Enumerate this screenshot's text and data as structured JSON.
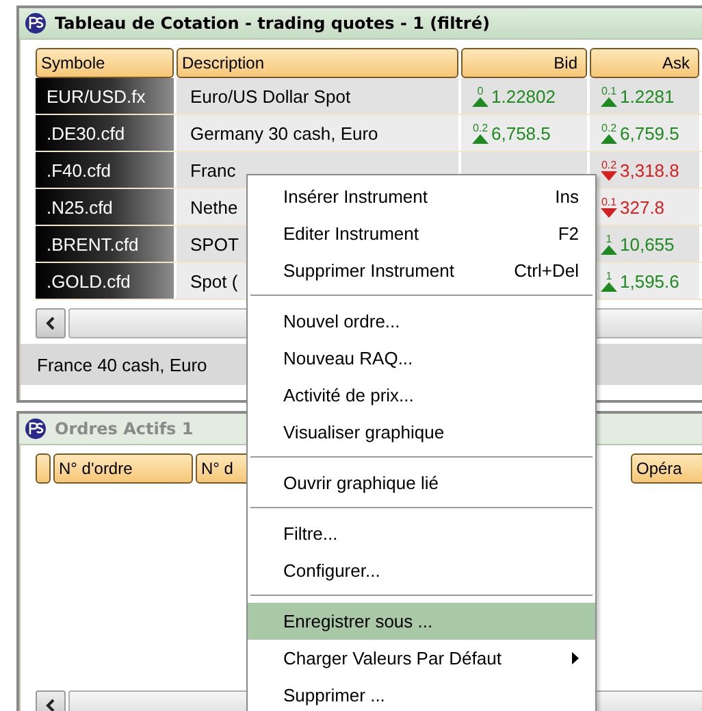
{
  "quotes_window": {
    "title": "Tableau de Cotation - trading quotes - 1 (filtré)",
    "columns": [
      "Symbole",
      "Description",
      "Bid",
      "Ask"
    ],
    "rows": [
      {
        "symbol": "EUR/USD.fx",
        "description": "Euro/US Dollar Spot",
        "bid": {
          "change": "0",
          "kind": "up",
          "value": "1.22802"
        },
        "ask": {
          "change": "0.1",
          "kind": "up",
          "value": "1.2281"
        }
      },
      {
        "symbol": ".DE30.cfd",
        "description": "Germany 30 cash, Euro",
        "bid": {
          "change": "0.2",
          "kind": "up",
          "value": "6,758.5"
        },
        "ask": {
          "change": "0.2",
          "kind": "up",
          "value": "6,759.5"
        }
      },
      {
        "symbol": ".F40.cfd",
        "description": "Franc",
        "ask": {
          "change": "0.2",
          "kind": "down",
          "value": "3,318.8"
        }
      },
      {
        "symbol": ".N25.cfd",
        "description": "Nethe",
        "ask": {
          "change": "0.1",
          "kind": "down",
          "value": "327.8"
        }
      },
      {
        "symbol": ".BRENT.cfd",
        "description": "SPOT",
        "ask": {
          "change": "1",
          "kind": "up",
          "value": "10,655"
        }
      },
      {
        "symbol": ".GOLD.cfd",
        "description": "Spot (",
        "ask": {
          "change": "1",
          "kind": "up",
          "value": "1,595.6"
        }
      }
    ],
    "status": "France 40 cash, Euro"
  },
  "orders_window": {
    "title": "Ordres Actifs 1",
    "columns": [
      "",
      "N° d'ordre",
      "N° d",
      "Opéra"
    ]
  },
  "context_menu": [
    {
      "kind": "item",
      "label": "Insérer Instrument",
      "shortcut": "Ins",
      "selected": false
    },
    {
      "kind": "item",
      "label": "Editer Instrument",
      "shortcut": "F2",
      "selected": false
    },
    {
      "kind": "item",
      "label": "Supprimer Instrument",
      "shortcut": "Ctrl+Del",
      "selected": false
    },
    {
      "kind": "separator"
    },
    {
      "kind": "item",
      "label": "Nouvel ordre...",
      "selected": false
    },
    {
      "kind": "item",
      "label": "Nouveau RAQ...",
      "selected": false
    },
    {
      "kind": "item",
      "label": "Activité de prix...",
      "selected": false
    },
    {
      "kind": "item",
      "label": "Visualiser graphique",
      "selected": false
    },
    {
      "kind": "separator"
    },
    {
      "kind": "item",
      "label": "Ouvrir graphique lié",
      "selected": false
    },
    {
      "kind": "separator"
    },
    {
      "kind": "item",
      "label": "Filtre...",
      "selected": false
    },
    {
      "kind": "item",
      "label": "Configurer...",
      "selected": false
    },
    {
      "kind": "separator"
    },
    {
      "kind": "item",
      "label": "Enregistrer sous ...",
      "selected": true
    },
    {
      "kind": "item",
      "label": "Charger Valeurs Par Défaut",
      "selected": false,
      "submenu": true
    },
    {
      "kind": "item",
      "label": "Supprimer ...",
      "selected": false
    }
  ]
}
